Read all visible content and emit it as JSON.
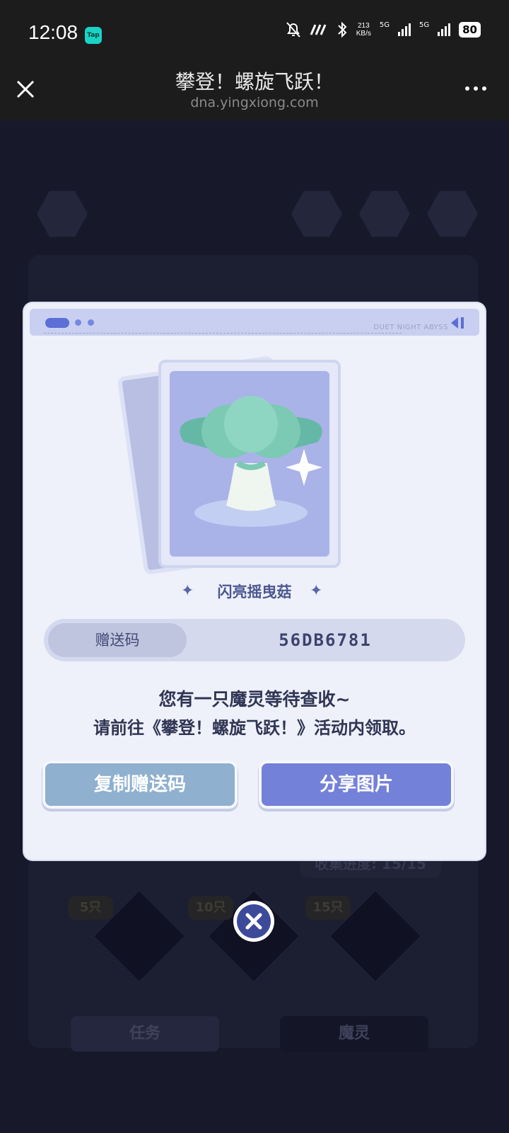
{
  "status_bar": {
    "time": "12:08",
    "app_badge": "Tap",
    "net_speed_value": "213",
    "net_speed_unit": "KB/s",
    "sim1_label": "5G",
    "sim2_label": "5G",
    "battery": "80"
  },
  "header": {
    "title": "攀登！螺旋飞跃！",
    "url": "dna.yingxiong.com"
  },
  "background": {
    "progress_label": "收集进度: 15/15",
    "milestones": [
      "5只",
      "10只",
      "15只"
    ],
    "task_button": "任务",
    "spirit_button": "魔灵"
  },
  "modal": {
    "top_tag": "DUET NIGHT ABYSS",
    "creature_name": "闪亮摇曳菇",
    "code_label": "赠送码",
    "code_value": "56DB6781",
    "message_line1": "您有一只魔灵等待查收~",
    "message_line2": "请前往《攀登！螺旋飞跃！》活动内领取。",
    "copy_button": "复制赠送码",
    "share_button": "分享图片"
  },
  "icons": [
    "close-icon",
    "more-icon",
    "home-icon",
    "help-icon",
    "music-icon",
    "share-icon",
    "close-circle-icon"
  ]
}
